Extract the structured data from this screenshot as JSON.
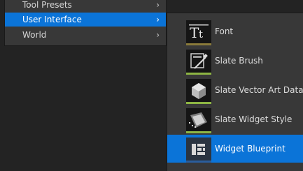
{
  "left_menu": {
    "items": [
      {
        "label": "Tool Presets",
        "chevron": "›"
      },
      {
        "label": "User Interface",
        "chevron": "›"
      },
      {
        "label": "World",
        "chevron": "›"
      }
    ]
  },
  "submenu": {
    "items": [
      {
        "label": "Font",
        "icon": "font-icon",
        "accent": "#8a7a3a"
      },
      {
        "label": "Slate Brush",
        "icon": "slate-brush-icon",
        "accent": "#8db543"
      },
      {
        "label": "Slate Vector Art Data",
        "icon": "vector-art-icon",
        "accent": "#8db543"
      },
      {
        "label": "Slate Widget Style",
        "icon": "widget-style-icon",
        "accent": "#8db543"
      },
      {
        "label": "Widget Blueprint",
        "icon": "widget-blueprint-icon",
        "accent": "#2b5e9c"
      }
    ]
  },
  "colors": {
    "selection": "#0b74d8",
    "menu_bg": "#383838",
    "background": "#232323"
  }
}
